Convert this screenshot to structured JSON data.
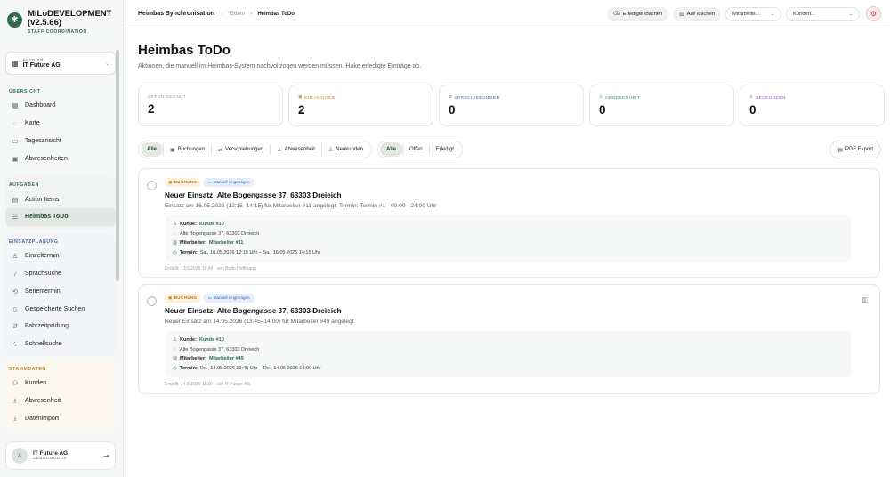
{
  "app": {
    "name": "MiLoDEVELOPMENT (v2.5.66)",
    "subtitle": "STAFF COORDINATION",
    "brand_color": "#2f6b4f"
  },
  "sidebar": {
    "betrieb_label": "BETRIEB",
    "betrieb_value": "IT Future AG",
    "sections": [
      {
        "title": "ÜBERSICHT",
        "items": [
          {
            "label": "Dashboard",
            "icon": "grid-icon"
          },
          {
            "label": "Karte",
            "icon": "map-pin-icon"
          },
          {
            "label": "Tagesansicht",
            "icon": "calendar-icon"
          },
          {
            "label": "Abwesenheiten",
            "icon": "calendar-off-icon"
          }
        ]
      },
      {
        "title": "AUFGABEN",
        "items": [
          {
            "label": "Action Items",
            "icon": "clipboard-icon"
          },
          {
            "label": "Heimbas ToDo",
            "icon": "list-check-icon",
            "active": true
          }
        ]
      },
      {
        "title": "EINSATZPLANUNG",
        "items": [
          {
            "label": "Einzeltermin",
            "icon": "user-plus-icon"
          },
          {
            "label": "Sprachsuche",
            "icon": "mic-icon"
          },
          {
            "label": "Serientermin",
            "icon": "repeat-icon"
          },
          {
            "label": "Gespeicherte Suchen",
            "icon": "bookmark-icon"
          },
          {
            "label": "Fahrzeitprüfung",
            "icon": "route-icon"
          },
          {
            "label": "Schnellsuche",
            "icon": "zap-icon"
          }
        ]
      },
      {
        "title": "STAMMDATEN",
        "items": [
          {
            "label": "Kunden",
            "icon": "users-icon"
          },
          {
            "label": "Abwesenheit",
            "icon": "user-x-icon"
          },
          {
            "label": "Datenimport",
            "icon": "download-icon"
          }
        ]
      }
    ],
    "user": {
      "name": "IT Future AG",
      "role": "DEBUGMODUS"
    }
  },
  "topbar": {
    "title": "Heimbas Synchronisation",
    "crumb_parent": "Extern",
    "crumb_current": "Heimbas ToDo",
    "btn_done_delete": "Erledigte löschen",
    "btn_all_delete": "Alle löschen",
    "select_staff": "Mitarbeiter...",
    "select_customer": "Kunden..."
  },
  "page": {
    "title": "Heimbas ToDo",
    "subtitle": "Aktionen, die manuell im Heimbas-System nachvollzogen werden müssen. Hake erledigte Einträge ab."
  },
  "stats": [
    {
      "label": "OFFEN GESAMT",
      "value": "2",
      "color": "#8a8f8d",
      "icon": ""
    },
    {
      "label": "BUCHUNGEN",
      "value": "2",
      "color": "#c98a2a",
      "icon": "calendar-icon"
    },
    {
      "label": "VERSCHIEBUNGEN",
      "value": "0",
      "color": "#3f63a6",
      "icon": "arrows-icon"
    },
    {
      "label": "ABWESENHEIT",
      "value": "0",
      "color": "#2f9b62",
      "icon": "user-x-icon"
    },
    {
      "label": "NEUKUNDEN",
      "value": "0",
      "color": "#8a55c9",
      "icon": "user-plus-icon"
    }
  ],
  "filters": {
    "types": [
      "Alle",
      "Buchungen",
      "Verschiebungen",
      "Abwesenheit",
      "Neukunden"
    ],
    "status": [
      "Alle",
      "Offen",
      "Erledigt"
    ],
    "pdf": "PDF Export"
  },
  "items": [
    {
      "type_badge": "BUCHUNG",
      "manual_badge": "Manuell eingetragen",
      "title": "Neuer Einsatz: Alte Bogengasse 37, 63303 Dreieich",
      "description": "Einsatz am 16.05.2026 (12:15–14:15) für Mitarbeiter #11 angelegt. Termin: Termin #1 · 00:00 - 24:00 Uhr",
      "kunde_label": "Kunde:",
      "kunde": "Kunde #10",
      "address": "Alte Bogengasse 37, 63303 Dreieich",
      "mitarbeiter_label": "Mitarbeiter:",
      "mitarbeiter": "Mitarbeiter #11",
      "termin_label": "Termin:",
      "termin": "Sa., 16.05.2026 12:15 Uhr – Sa., 16.05.2026 14:15 Uhr",
      "meta": "Erstellt: 13.5.2026 18:49 · von Bodo Hoffmann"
    },
    {
      "type_badge": "BUCHUNG",
      "manual_badge": "Manuell eingetragen",
      "title": "Neuer Einsatz: Alte Bogengasse 37, 63303 Dreieich",
      "description": "Neuer Einsatz am 14.05.2026 (13:45–14:00) für Mitarbeiter #49 angelegt",
      "kunde_label": "Kunde:",
      "kunde": "Kunde #10",
      "address": "Alte Bogengasse 37, 63303 Dreieich",
      "mitarbeiter_label": "Mitarbeiter:",
      "mitarbeiter": "Mitarbeiter #49",
      "termin_label": "Termin:",
      "termin": "Do., 14.05.2026 13:45 Uhr – Do., 14.05.2026 14:00 Uhr",
      "meta": "Erstellt: 14.5.2026 11:20 · von IT Future AG"
    }
  ]
}
